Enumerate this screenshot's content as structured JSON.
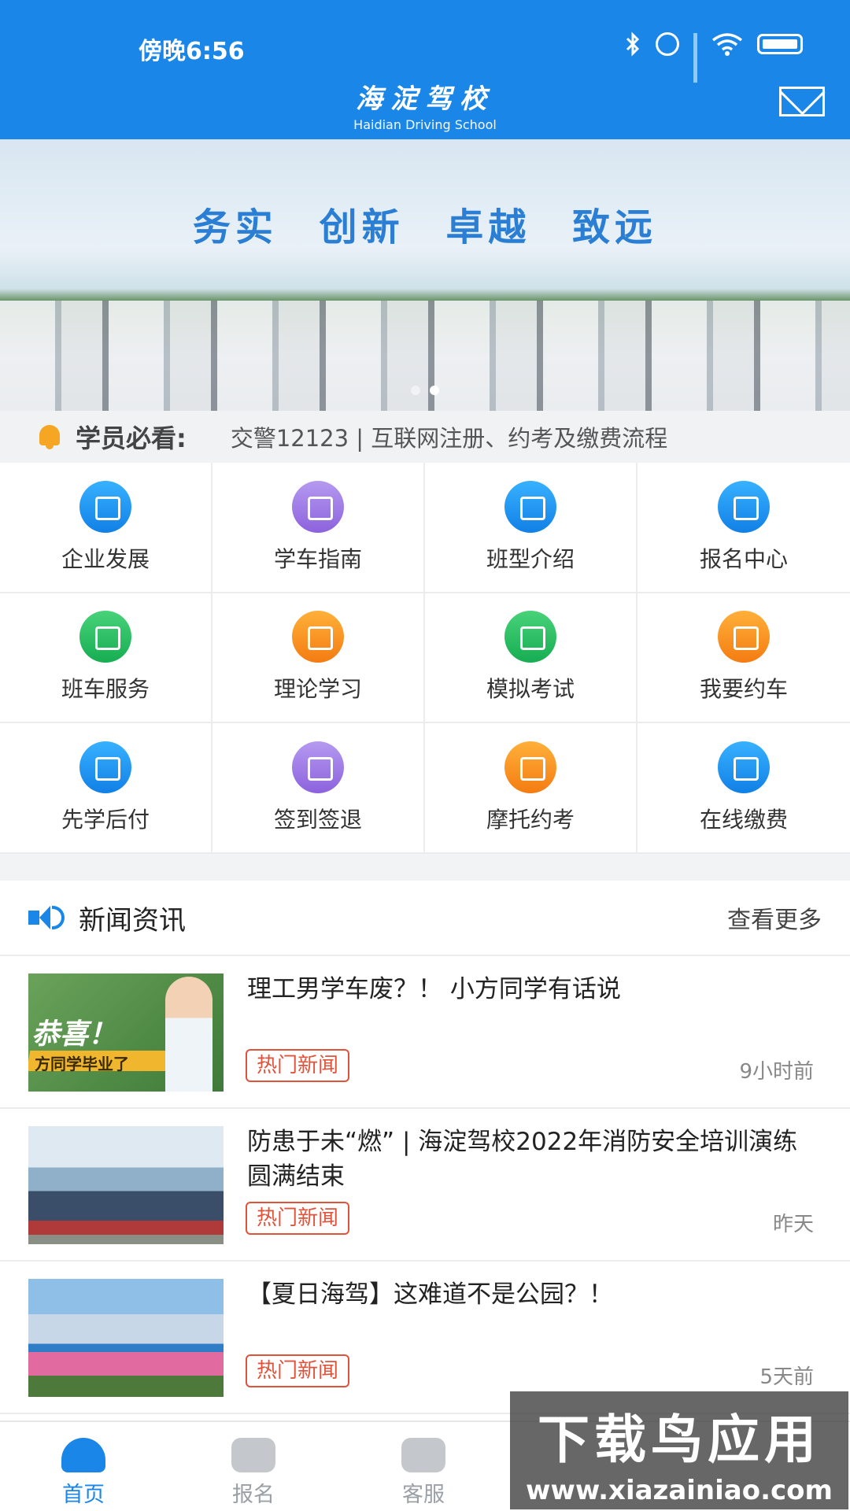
{
  "status": {
    "time": "傍晚6:56"
  },
  "header": {
    "logo_cn": "海淀驾校",
    "logo_en": "Haidian Driving School",
    "mail_icon": "mail-icon"
  },
  "banner": {
    "slogan": "务实 创新 卓越 致远",
    "dots": 2,
    "active_dot": 2
  },
  "notice": {
    "title": "学员必看:",
    "text": "交警12123 | 互联网注册、约考及缴费流程"
  },
  "menu": [
    {
      "label": "企业发展",
      "icon": "building-icon",
      "color": "blue"
    },
    {
      "label": "学车指南",
      "icon": "books-icon",
      "color": "purple"
    },
    {
      "label": "班型介绍",
      "icon": "board-icon",
      "color": "blue"
    },
    {
      "label": "报名中心",
      "icon": "id-card-icon",
      "color": "blue"
    },
    {
      "label": "班车服务",
      "icon": "bus-icon",
      "color": "green"
    },
    {
      "label": "理论学习",
      "icon": "monitor-icon",
      "color": "orange"
    },
    {
      "label": "模拟考试",
      "icon": "exam-icon",
      "color": "green"
    },
    {
      "label": "我要约车",
      "icon": "car-icon",
      "color": "orange"
    },
    {
      "label": "先学后付",
      "icon": "user-pay-icon",
      "color": "blue"
    },
    {
      "label": "签到签退",
      "icon": "calendar-check-icon",
      "color": "purple"
    },
    {
      "label": "摩托约考",
      "icon": "motorcycle-icon",
      "color": "orange"
    },
    {
      "label": "在线缴费",
      "icon": "wallet-icon",
      "color": "blue"
    }
  ],
  "news": {
    "title": "新闻资讯",
    "more": "查看更多",
    "items": [
      {
        "title": "理工男学车废？！ 小方同学有话说",
        "tag": "热门新闻",
        "time": "9小时前",
        "thumb_text": "恭喜！",
        "thumb_caption": "方同学毕业了"
      },
      {
        "title": "防患于未“燃” | 海淀驾校2022年消防安全培训演练圆满结束",
        "tag": "热门新闻",
        "time": "昨天"
      },
      {
        "title": "【夏日海驾】这难道不是公园？！",
        "tag": "热门新闻",
        "time": "5天前"
      }
    ]
  },
  "tabbar": [
    {
      "label": "首页",
      "icon": "home-icon",
      "active": true
    },
    {
      "label": "报名",
      "icon": "signup-icon",
      "active": false
    },
    {
      "label": "客服",
      "icon": "service-icon",
      "active": false
    }
  ],
  "watermark": {
    "title": "下载鸟应用",
    "url": "www.xiazainiao.com"
  },
  "colors": {
    "primary": "#1a86e8",
    "tag": "#e0533b",
    "notice_bell": "#f5a623"
  }
}
